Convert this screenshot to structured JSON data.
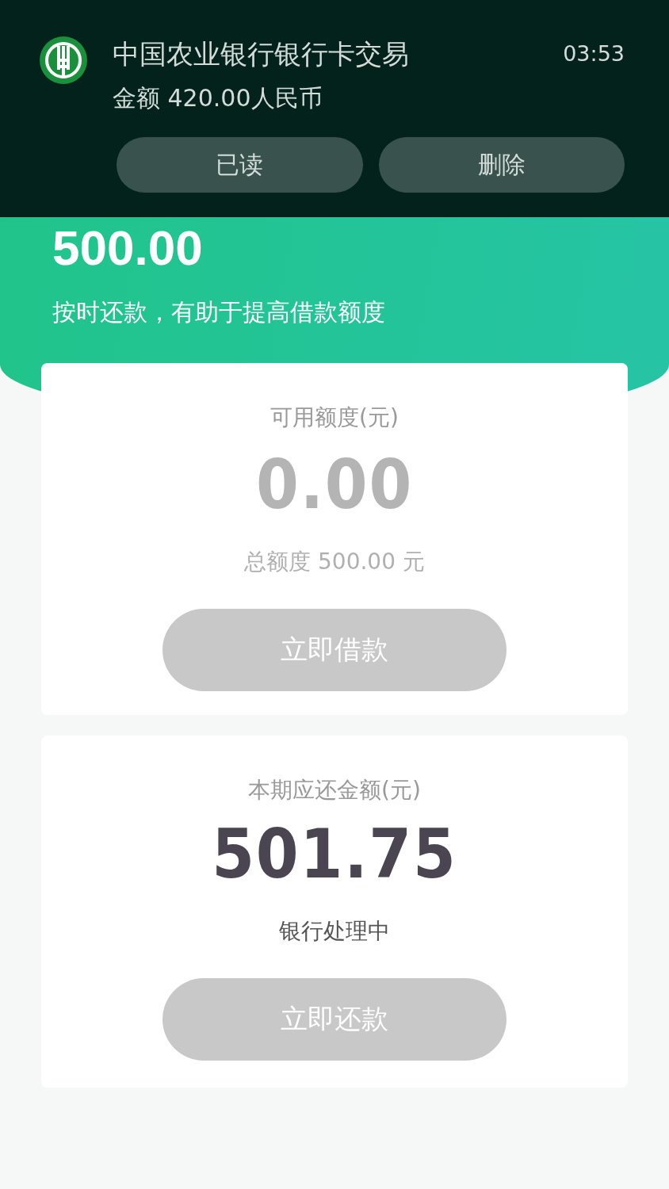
{
  "credit": {
    "amount": "500.00",
    "tip": "按时还款，有助于提高借款额度"
  },
  "cards": [
    {
      "label": "可用额度(元)",
      "amount": "0.00",
      "note": "总额度 500.00 元",
      "muted": true,
      "button": {
        "label": "立即借款",
        "disabled": true
      }
    },
    {
      "label": "本期应还金额(元)",
      "amount": "501.75",
      "note": "银行处理中",
      "muted": false,
      "button": {
        "label": "立即还款",
        "disabled": true
      }
    }
  ],
  "notification": {
    "title": "中国农业银行银行卡交易",
    "body": "金额 420.00人民币",
    "time": "03:53",
    "actions": [
      "已读",
      "删除"
    ]
  }
}
